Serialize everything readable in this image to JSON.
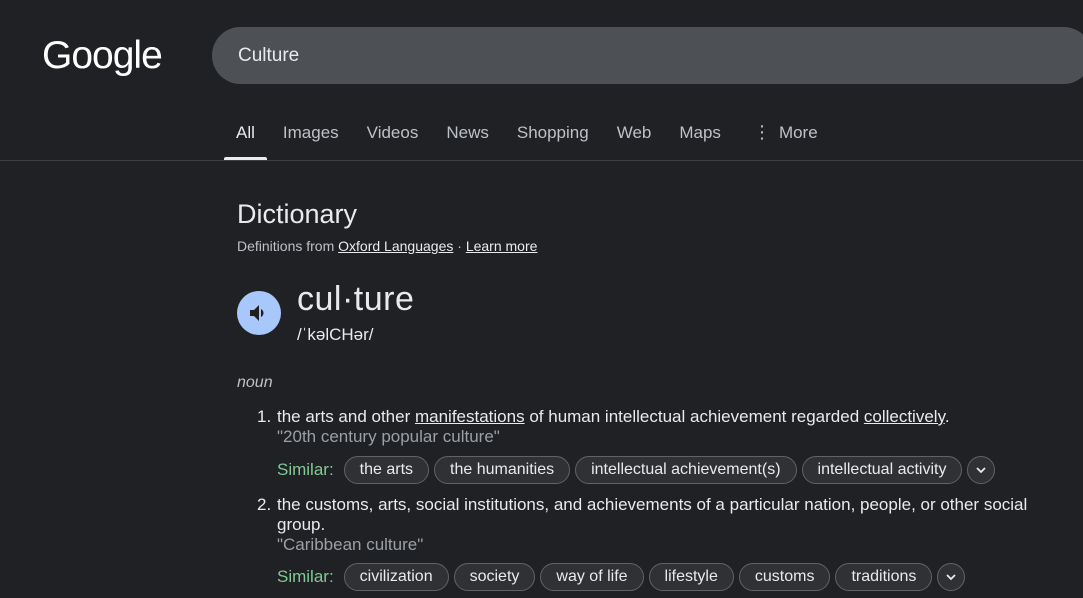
{
  "logo": "Google",
  "search": {
    "query": "Culture"
  },
  "tabs": [
    {
      "label": "All"
    },
    {
      "label": "Images"
    },
    {
      "label": "Videos"
    },
    {
      "label": "News"
    },
    {
      "label": "Shopping"
    },
    {
      "label": "Web"
    },
    {
      "label": "Maps"
    },
    {
      "label": "More"
    }
  ],
  "dictionary": {
    "title": "Dictionary",
    "source_prefix": "Definitions from",
    "source_link": "Oxford Languages",
    "separator": "·",
    "learn_more": "Learn more",
    "headword": "cul·ture",
    "phonetic": "/ˈkəlCHər/",
    "part_of_speech": "noun",
    "definitions": [
      {
        "number": "1.",
        "parts": [
          "the arts and other ",
          "manifestations",
          " of human intellectual achievement regarded ",
          "collectively",
          "."
        ],
        "example": "\"20th century popular culture\"",
        "similar_label": "Similar:",
        "similar": [
          "the arts",
          "the humanities",
          "intellectual achievement(s)",
          "intellectual activity"
        ]
      },
      {
        "number": "2.",
        "line1": "the customs, arts, social institutions, and achievements of a particular nation, people, or other social",
        "line2": "group.",
        "example": "\"Caribbean culture\"",
        "similar_label": "Similar:",
        "similar": [
          "civilization",
          "society",
          "way of life",
          "lifestyle",
          "customs",
          "traditions"
        ]
      }
    ]
  },
  "colors": {
    "background": "#202124",
    "accent_green": "#81c995",
    "speaker_blue": "#a8c7fa"
  },
  "icons": [
    "speaker-icon",
    "more-dots-icon",
    "chevron-down-icon"
  ]
}
